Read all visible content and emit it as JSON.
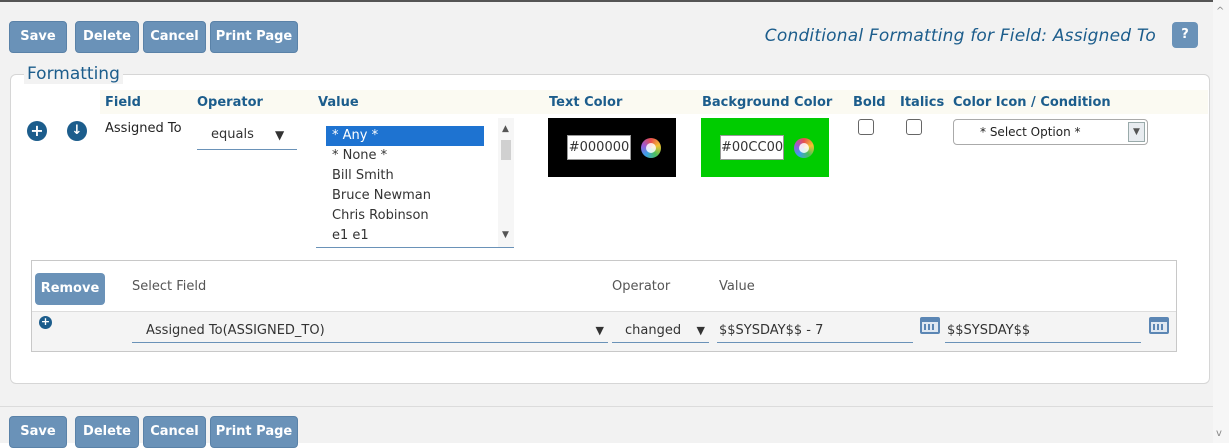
{
  "toolbar": {
    "save": "Save",
    "delete": "Delete",
    "cancel": "Cancel",
    "print": "Print Page",
    "title": "Conditional Formatting for Field: Assigned To",
    "help": "?"
  },
  "formatting": {
    "legend": "Formatting",
    "headers": {
      "field": "Field",
      "operator": "Operator",
      "value": "Value",
      "text_color": "Text Color",
      "background_color": "Background Color",
      "bold": "Bold",
      "italics": "Italics",
      "color_icon": "Color Icon / Condition"
    },
    "row": {
      "field_name": "Assigned To",
      "operator": "equals",
      "value_options": [
        "* Any *",
        "* None *",
        "Bill Smith",
        "Bruce Newman",
        "Chris Robinson",
        "e1 e1"
      ],
      "selected_value": "* Any *",
      "text_color": "#000000",
      "background_color": "#00CC00",
      "bold": false,
      "italics": false,
      "color_icon_selected": "* Select Option *"
    }
  },
  "condition": {
    "remove": "Remove",
    "headers": {
      "select_field": "Select Field",
      "operator": "Operator",
      "value": "Value"
    },
    "row": {
      "field": "Assigned To(ASSIGNED_TO)",
      "operator": "changed",
      "value_from": "$$SYSDAY$$ - 7",
      "value_to": "$$SYSDAY$$"
    }
  },
  "colors": {
    "accent": "#6a92b8",
    "title": "#1c5d8c",
    "text_swatch": "#000000",
    "background_swatch": "#00CC00"
  }
}
